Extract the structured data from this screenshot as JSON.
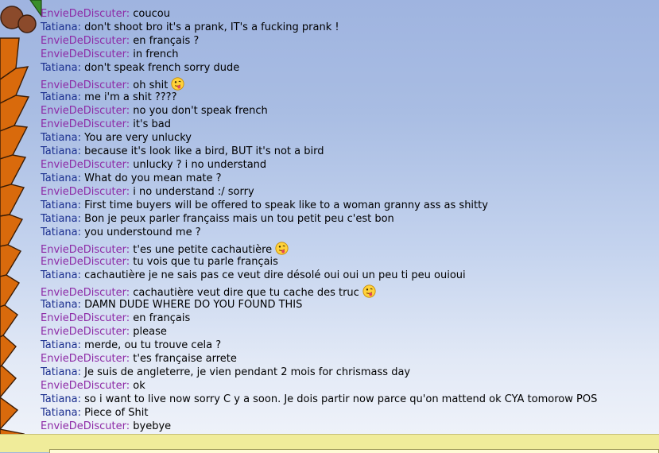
{
  "colors": {
    "nick_envie": "#8d2aa6",
    "nick_tatiana": "#1b2f8f",
    "input_bar": "#f0ec9a"
  },
  "icons": {
    "smiley": "tongue-out-smiley-icon",
    "tree": "palm-tree-decoration"
  },
  "messages": [
    {
      "nick": "EnvieDeDiscuter",
      "text": "coucou"
    },
    {
      "nick": "Tatiana",
      "text": "don't shoot bro it's a prank, IT's a fucking prank !"
    },
    {
      "nick": "EnvieDeDiscuter",
      "text": "en français ?"
    },
    {
      "nick": "EnvieDeDiscuter",
      "text": "in french"
    },
    {
      "nick": "Tatiana",
      "text": "don't speak french sorry dude"
    },
    {
      "nick": "EnvieDeDiscuter",
      "text": "oh shit",
      "emoji": true
    },
    {
      "nick": "Tatiana",
      "text": "me i'm a shit ????"
    },
    {
      "nick": "EnvieDeDiscuter",
      "text": "no you don't speak french"
    },
    {
      "nick": "EnvieDeDiscuter",
      "text": "it's bad"
    },
    {
      "nick": "Tatiana",
      "text": "You are very unlucky"
    },
    {
      "nick": "Tatiana",
      "text": "because it's look like a bird, BUT it's not a bird"
    },
    {
      "nick": "EnvieDeDiscuter",
      "text": "unlucky ? i no understand"
    },
    {
      "nick": "Tatiana",
      "text": "What do you mean mate ?"
    },
    {
      "nick": "EnvieDeDiscuter",
      "text": "i no understand :/ sorry"
    },
    {
      "nick": "Tatiana",
      "text": "First time buyers will be offered to speak like to a woman granny ass as shitty"
    },
    {
      "nick": "Tatiana",
      "text": "Bon je peux parler françaiss mais un tou petit peu c'est bon"
    },
    {
      "nick": "Tatiana",
      "text": "you understound me ?"
    },
    {
      "nick": "EnvieDeDiscuter",
      "text": "t'es une petite cachautière",
      "emoji": true
    },
    {
      "nick": "EnvieDeDiscuter",
      "text": "tu vois que tu parle français"
    },
    {
      "nick": "Tatiana",
      "text": "cachautière je ne sais pas ce veut dire désolé oui oui un peu ti peu ouioui"
    },
    {
      "nick": "EnvieDeDiscuter",
      "text": "cachautière veut dire que tu cache des truc",
      "emoji": true
    },
    {
      "nick": "Tatiana",
      "text": "DAMN DUDE WHERE DO YOU FOUND THIS"
    },
    {
      "nick": "EnvieDeDiscuter",
      "text": "en français"
    },
    {
      "nick": "EnvieDeDiscuter",
      "text": "please"
    },
    {
      "nick": "Tatiana",
      "text": "merde, ou tu trouve cela ?"
    },
    {
      "nick": "EnvieDeDiscuter",
      "text": "t'es française arrete"
    },
    {
      "nick": "Tatiana",
      "text": "Je suis de angleterre, je vien pendant 2 mois for chrismass day"
    },
    {
      "nick": "EnvieDeDiscuter",
      "text": "ok"
    },
    {
      "nick": "Tatiana",
      "text": "so i want to live now sorry C y a soon. Je dois partir now parce qu'on mattend ok CYA tomorow POS"
    },
    {
      "nick": "Tatiana",
      "text": "Piece of Shit"
    },
    {
      "nick": "EnvieDeDiscuter",
      "text": "byebye"
    }
  ]
}
